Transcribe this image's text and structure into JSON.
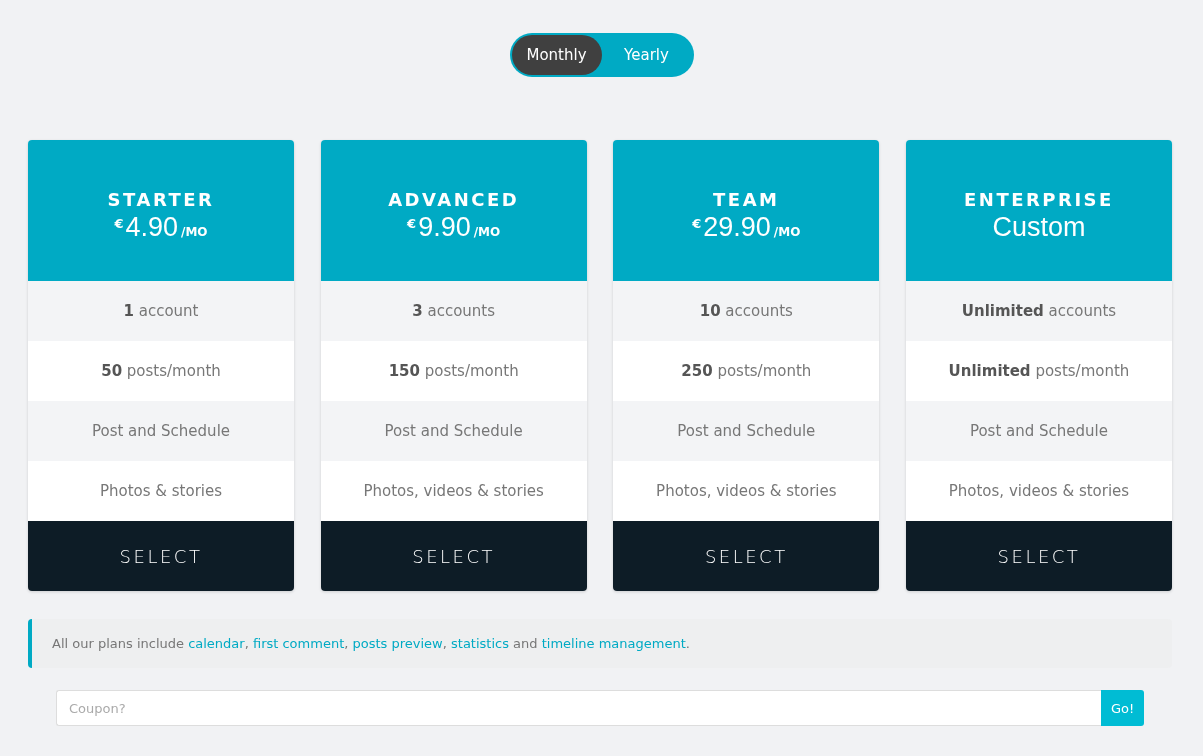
{
  "billing_toggle": [
    {
      "label": "Monthly",
      "selected": true
    },
    {
      "label": "Yearly",
      "selected": false
    }
  ],
  "plans": [
    {
      "name": "STARTER",
      "kind": "priced",
      "currency": "€",
      "amount": "4.90",
      "period": "/MO",
      "features": [
        "**1** account",
        "**50** posts/month",
        "Post and Schedule",
        "Photos & stories"
      ],
      "button": "SELECT"
    },
    {
      "name": "ADVANCED",
      "kind": "priced",
      "currency": "€",
      "amount": "9.90",
      "period": "/MO",
      "features": [
        "**3** accounts",
        "**150** posts/month",
        "Post and Schedule",
        "Photos, videos & stories"
      ],
      "button": "SELECT"
    },
    {
      "name": "TEAM",
      "kind": "priced",
      "currency": "€",
      "amount": "29.90",
      "period": "/MO",
      "features": [
        "**10** accounts",
        "**250** posts/month",
        "Post and Schedule",
        "Photos, videos & stories"
      ],
      "button": "SELECT"
    },
    {
      "name": "ENTERPRISE",
      "kind": "custom",
      "price": "Custom",
      "features": [
        "**Unlimited** accounts",
        "**Unlimited** posts/month",
        "Post and Schedule",
        "Photos, videos & stories"
      ],
      "button": "SELECT"
    }
  ],
  "notice": [
    {
      "kind": "text",
      "text": "All our plans include "
    },
    {
      "kind": "link",
      "text": "calendar"
    },
    {
      "kind": "text",
      "text": ", "
    },
    {
      "kind": "link",
      "text": "first comment"
    },
    {
      "kind": "text",
      "text": ", "
    },
    {
      "kind": "link",
      "text": "posts preview"
    },
    {
      "kind": "text",
      "text": ", "
    },
    {
      "kind": "link",
      "text": "statistics"
    },
    {
      "kind": "text",
      "text": " and "
    },
    {
      "kind": "link",
      "text": "timeline management"
    },
    {
      "kind": "text",
      "text": "."
    }
  ],
  "coupon": {
    "placeholder": "Coupon?",
    "button": "Go!"
  }
}
